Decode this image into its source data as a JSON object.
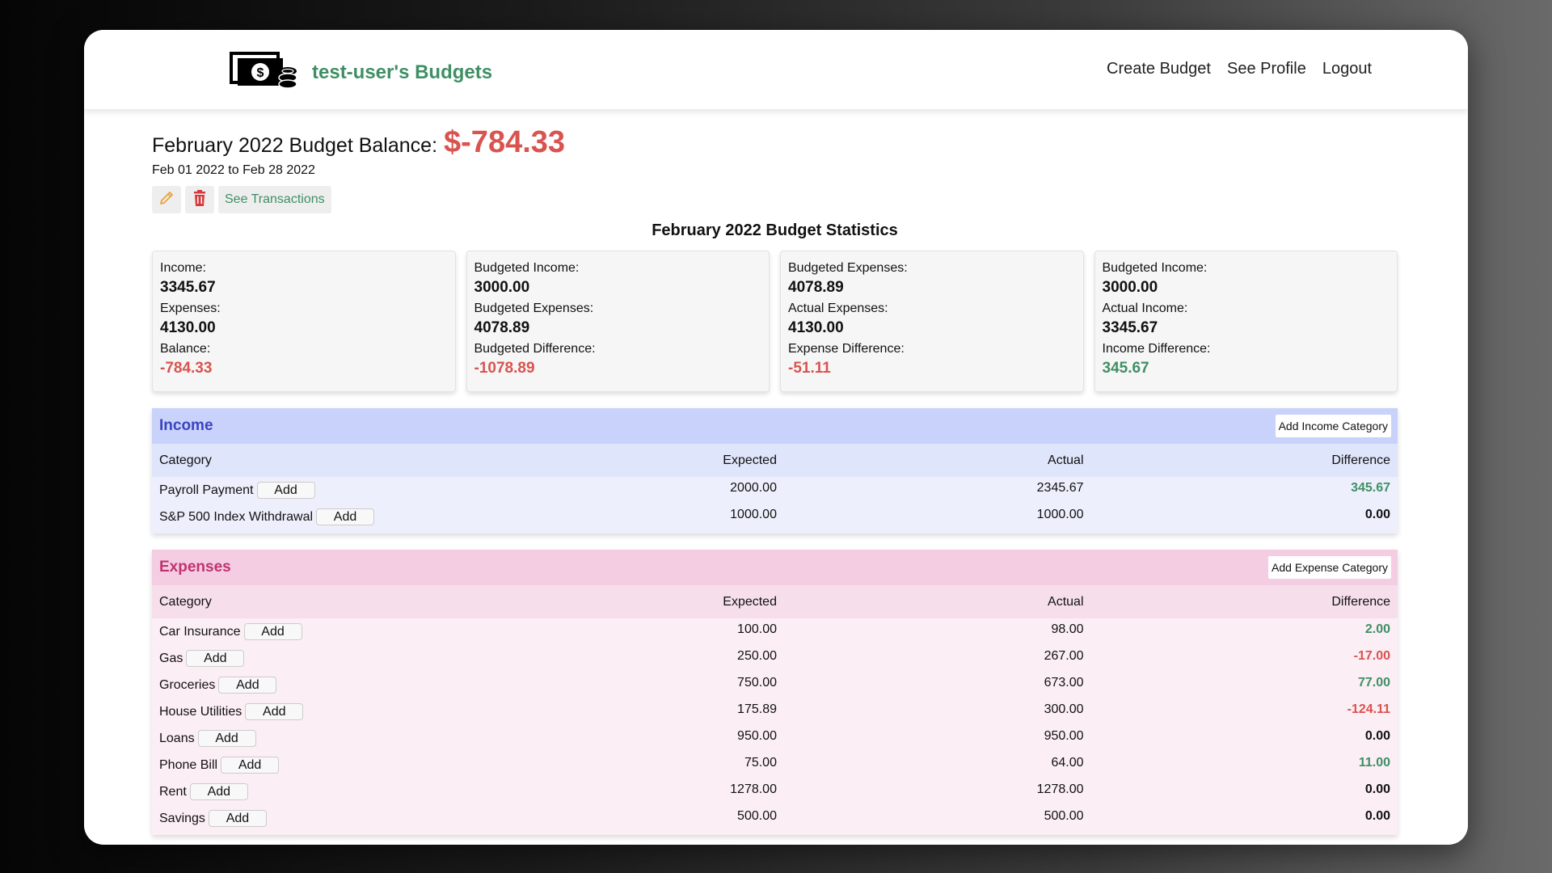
{
  "nav": {
    "title": "test-user's Budgets",
    "links": [
      "Create Budget",
      "See Profile",
      "Logout"
    ]
  },
  "budget": {
    "balance_label": "February 2022 Budget Balance:",
    "balance_value": "$-784.33",
    "date_range": "Feb 01 2022 to Feb 28 2022",
    "see_transactions": "See Transactions",
    "stats_title": "February 2022 Budget Statistics"
  },
  "stats": [
    [
      {
        "label": "Income:",
        "value": "3345.67",
        "tone": ""
      },
      {
        "label": "Expenses:",
        "value": "4130.00",
        "tone": ""
      },
      {
        "label": "Balance:",
        "value": "-784.33",
        "tone": "neg"
      }
    ],
    [
      {
        "label": "Budgeted Income:",
        "value": "3000.00",
        "tone": ""
      },
      {
        "label": "Budgeted Expenses:",
        "value": "4078.89",
        "tone": ""
      },
      {
        "label": "Budgeted Difference:",
        "value": "-1078.89",
        "tone": "neg"
      }
    ],
    [
      {
        "label": "Budgeted Expenses:",
        "value": "4078.89",
        "tone": ""
      },
      {
        "label": "Actual Expenses:",
        "value": "4130.00",
        "tone": ""
      },
      {
        "label": "Expense Difference:",
        "value": "-51.11",
        "tone": "neg"
      }
    ],
    [
      {
        "label": "Budgeted Income:",
        "value": "3000.00",
        "tone": ""
      },
      {
        "label": "Actual Income:",
        "value": "3345.67",
        "tone": ""
      },
      {
        "label": "Income Difference:",
        "value": "345.67",
        "tone": "pos"
      }
    ]
  ],
  "columns": {
    "category": "Category",
    "expected": "Expected",
    "actual": "Actual",
    "difference": "Difference"
  },
  "add_label": "Add",
  "income": {
    "title": "Income",
    "add_button": "Add Income Category",
    "rows": [
      {
        "category": "Payroll Payment",
        "expected": "2000.00",
        "actual": "2345.67",
        "difference": "345.67",
        "tone": "pos"
      },
      {
        "category": "S&P 500 Index Withdrawal",
        "expected": "1000.00",
        "actual": "1000.00",
        "difference": "0.00",
        "tone": "zero"
      }
    ]
  },
  "expenses": {
    "title": "Expenses",
    "add_button": "Add Expense Category",
    "rows": [
      {
        "category": "Car Insurance",
        "expected": "100.00",
        "actual": "98.00",
        "difference": "2.00",
        "tone": "pos"
      },
      {
        "category": "Gas",
        "expected": "250.00",
        "actual": "267.00",
        "difference": "-17.00",
        "tone": "neg"
      },
      {
        "category": "Groceries",
        "expected": "750.00",
        "actual": "673.00",
        "difference": "77.00",
        "tone": "pos"
      },
      {
        "category": "House Utilities",
        "expected": "175.89",
        "actual": "300.00",
        "difference": "-124.11",
        "tone": "neg"
      },
      {
        "category": "Loans",
        "expected": "950.00",
        "actual": "950.00",
        "difference": "0.00",
        "tone": "zero"
      },
      {
        "category": "Phone Bill",
        "expected": "75.00",
        "actual": "64.00",
        "difference": "11.00",
        "tone": "pos"
      },
      {
        "category": "Rent",
        "expected": "1278.00",
        "actual": "1278.00",
        "difference": "0.00",
        "tone": "zero"
      },
      {
        "category": "Savings",
        "expected": "500.00",
        "actual": "500.00",
        "difference": "0.00",
        "tone": "zero"
      }
    ]
  }
}
